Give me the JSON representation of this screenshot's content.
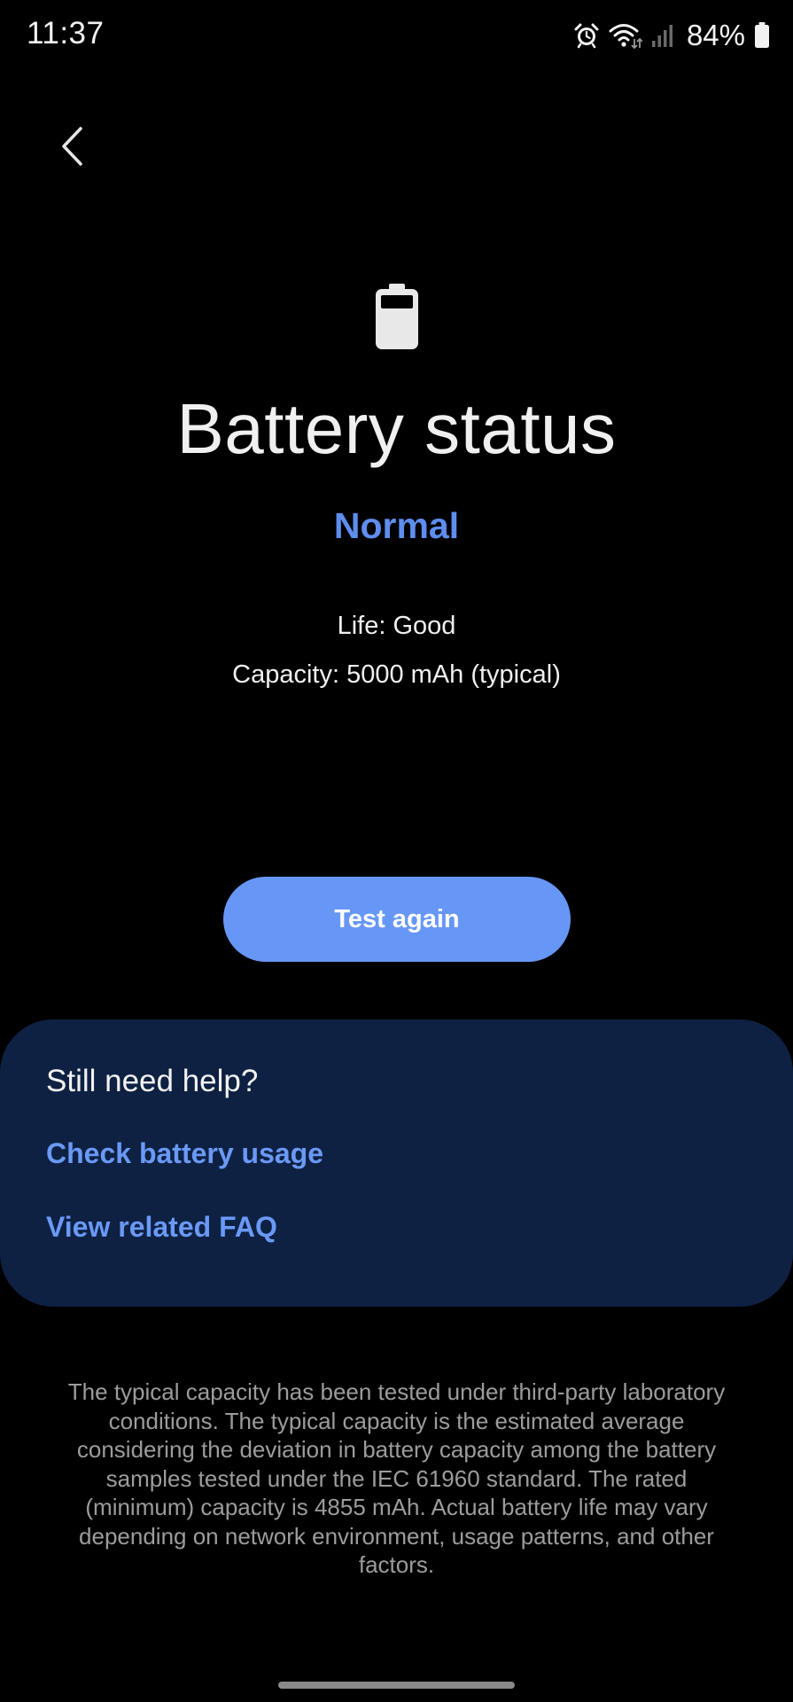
{
  "status_bar": {
    "time": "11:37",
    "battery_percent": "84%",
    "icons": [
      "alarm-icon",
      "wifi-icon",
      "cell-signal-icon",
      "battery-icon"
    ]
  },
  "header": {
    "back_icon": "chevron-left-icon"
  },
  "main": {
    "hero_icon": "battery-icon",
    "title": "Battery status",
    "status": "Normal",
    "life": "Life: Good",
    "capacity": "Capacity: 5000 mAh (typical)",
    "test_again_label": "Test again"
  },
  "help_card": {
    "title": "Still need help?",
    "links": [
      {
        "label": "Check battery usage"
      },
      {
        "label": "View related FAQ"
      }
    ]
  },
  "disclaimer": "The typical capacity has been tested under third-party laboratory conditions. The typical capacity is the estimated average considering the deviation in battery capacity among the battery samples tested under the IEC 61960 standard. The rated (minimum) capacity is 4855 mAh. Actual battery life may vary depending on network environment, usage patterns, and other factors.",
  "colors": {
    "background": "#000000",
    "accent": "#6797f6",
    "status_text": "#5e8ef0",
    "card_background": "#0e2143",
    "disclaimer_text": "#9c9c9c"
  }
}
